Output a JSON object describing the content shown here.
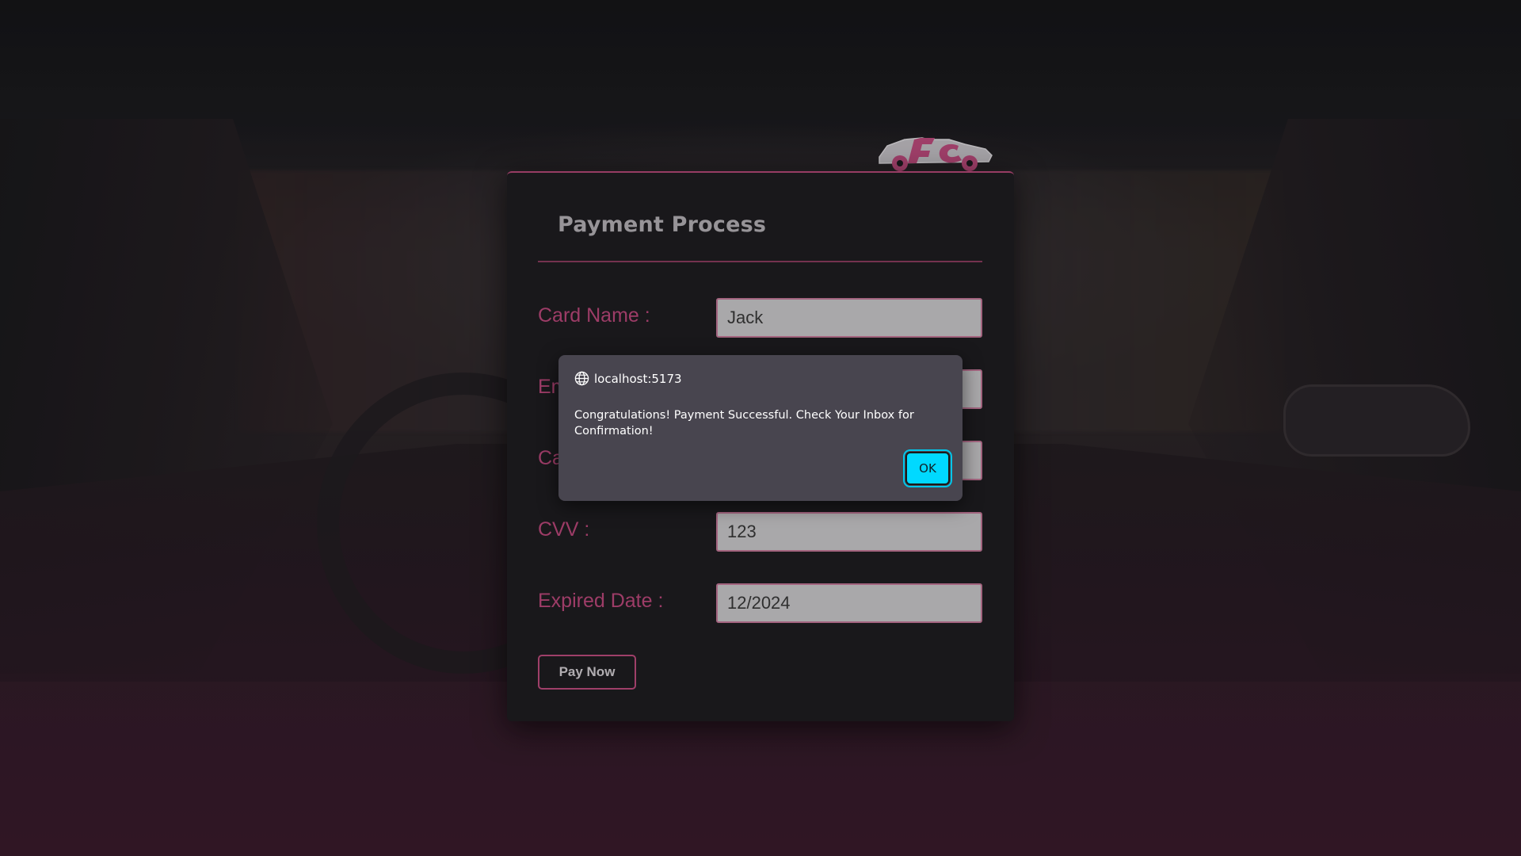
{
  "form": {
    "title": "Payment Process",
    "fields": [
      {
        "label": "Card Name :",
        "value": "Jack"
      },
      {
        "label": "Email :",
        "value": ""
      },
      {
        "label": "Card Number :",
        "value": ""
      },
      {
        "label": "CVV :",
        "value": "123"
      },
      {
        "label": "Expired Date :",
        "value": "12/2024"
      }
    ],
    "pay_label": "Pay Now"
  },
  "dialog": {
    "origin": "localhost:5173",
    "message": "Congratulations! Payment Successful. Check Your Inbox for Confirmation!",
    "ok_label": "OK",
    "ok_color": "#00d9ff"
  },
  "colors": {
    "accent": "#c04a7e",
    "card_bg": "#1f1e22",
    "dialog_bg": "#48454f"
  },
  "icons": {
    "logo": "car-logo-icon",
    "origin": "globe-icon"
  }
}
